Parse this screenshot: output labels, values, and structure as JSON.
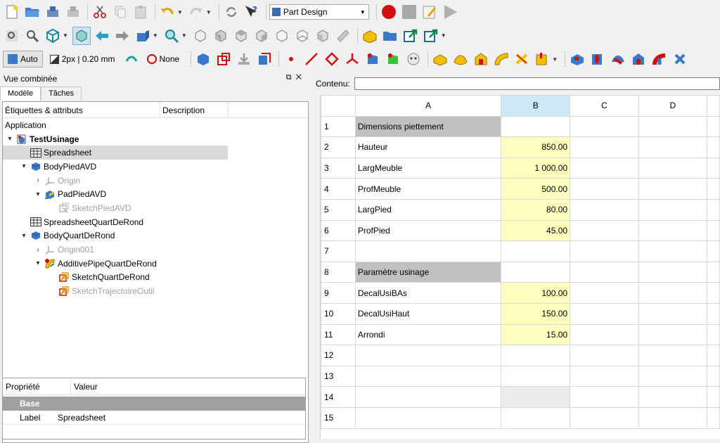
{
  "toolbar": {
    "workbench": "Part Design",
    "draw_style": "Auto",
    "line_width": "2px | 0.20 mm",
    "selection_filter": "None"
  },
  "panel": {
    "title": "Vue combinée",
    "tabs": [
      "Modèle",
      "Tâches"
    ],
    "tree_header": {
      "col1": "Étiquettes & attributs",
      "col2": "Description"
    },
    "tree": [
      {
        "label": "Application",
        "level": 0,
        "icon": "none",
        "dim": false,
        "bold": false,
        "arrow": ""
      },
      {
        "label": "TestUsinage",
        "level": 0,
        "icon": "document-icon",
        "dim": false,
        "bold": true,
        "arrow": "▾"
      },
      {
        "label": "Spreadsheet",
        "level": 1,
        "icon": "spreadsheet-icon",
        "dim": false,
        "bold": false,
        "arrow": "",
        "selected": true
      },
      {
        "label": "BodyPiedAVD",
        "level": 1,
        "icon": "body-icon",
        "dim": false,
        "bold": false,
        "arrow": "▾"
      },
      {
        "label": "Origin",
        "level": 2,
        "icon": "origin-icon",
        "dim": true,
        "bold": false,
        "arrow": "›"
      },
      {
        "label": "PadPiedAVD",
        "level": 2,
        "icon": "pad-icon",
        "dim": false,
        "bold": false,
        "arrow": "▾"
      },
      {
        "label": "SketchPiedAVD",
        "level": 3,
        "icon": "sketch-icon",
        "dim": true,
        "bold": false,
        "arrow": ""
      },
      {
        "label": "SpreadsheetQuartDeRond",
        "level": 1,
        "icon": "spreadsheet-icon",
        "dim": false,
        "bold": false,
        "arrow": ""
      },
      {
        "label": "BodyQuartDeRond",
        "level": 1,
        "icon": "body-icon",
        "dim": false,
        "bold": false,
        "arrow": "▾"
      },
      {
        "label": "Origin001",
        "level": 2,
        "icon": "origin-icon",
        "dim": true,
        "bold": false,
        "arrow": "›"
      },
      {
        "label": "AdditivePipeQuartDeRond",
        "level": 2,
        "icon": "pipe-icon",
        "dim": false,
        "bold": false,
        "arrow": "▾"
      },
      {
        "label": "SketchQuartDeRond",
        "level": 3,
        "icon": "sketch-error-icon",
        "dim": false,
        "bold": false,
        "arrow": ""
      },
      {
        "label": "SketchTrajectoireOutil",
        "level": 3,
        "icon": "sketch-error-icon",
        "dim": true,
        "bold": false,
        "arrow": ""
      }
    ],
    "props_header": {
      "col1": "Propriété",
      "col2": "Valeur"
    },
    "props_group": "Base",
    "props": [
      {
        "name": "Label",
        "value": "Spreadsheet"
      }
    ]
  },
  "content_label": "Contenu:",
  "sheet": {
    "columns": [
      "A",
      "B",
      "C",
      "D"
    ],
    "rows": [
      {
        "n": "1",
        "a": "Dimensions piettement",
        "b": "",
        "style": "hdr"
      },
      {
        "n": "2",
        "a": "Hauteur",
        "b": "850.00",
        "style": "val"
      },
      {
        "n": "3",
        "a": "LargMeuble",
        "b": "1 000.00",
        "style": "val"
      },
      {
        "n": "4",
        "a": "ProfMeuble",
        "b": "500.00",
        "style": "val"
      },
      {
        "n": "5",
        "a": "LargPied",
        "b": "80.00",
        "style": "val"
      },
      {
        "n": "6",
        "a": "ProfPied",
        "b": "45.00",
        "style": "val"
      },
      {
        "n": "7",
        "a": "",
        "b": "",
        "style": "empty"
      },
      {
        "n": "8",
        "a": "Paramètre usinage",
        "b": "",
        "style": "hdr"
      },
      {
        "n": "9",
        "a": "DecalUsiBAs",
        "b": "100.00",
        "style": "val"
      },
      {
        "n": "10",
        "a": "DecalUsiHaut",
        "b": "150.00",
        "style": "val"
      },
      {
        "n": "11",
        "a": "Arrondi",
        "b": "15.00",
        "style": "val"
      },
      {
        "n": "12",
        "a": "",
        "b": "",
        "style": "empty"
      },
      {
        "n": "13",
        "a": "",
        "b": "",
        "style": "empty"
      },
      {
        "n": "14",
        "a": "",
        "b": "",
        "style": "grayb"
      },
      {
        "n": "15",
        "a": "",
        "b": "",
        "style": "empty"
      }
    ]
  }
}
